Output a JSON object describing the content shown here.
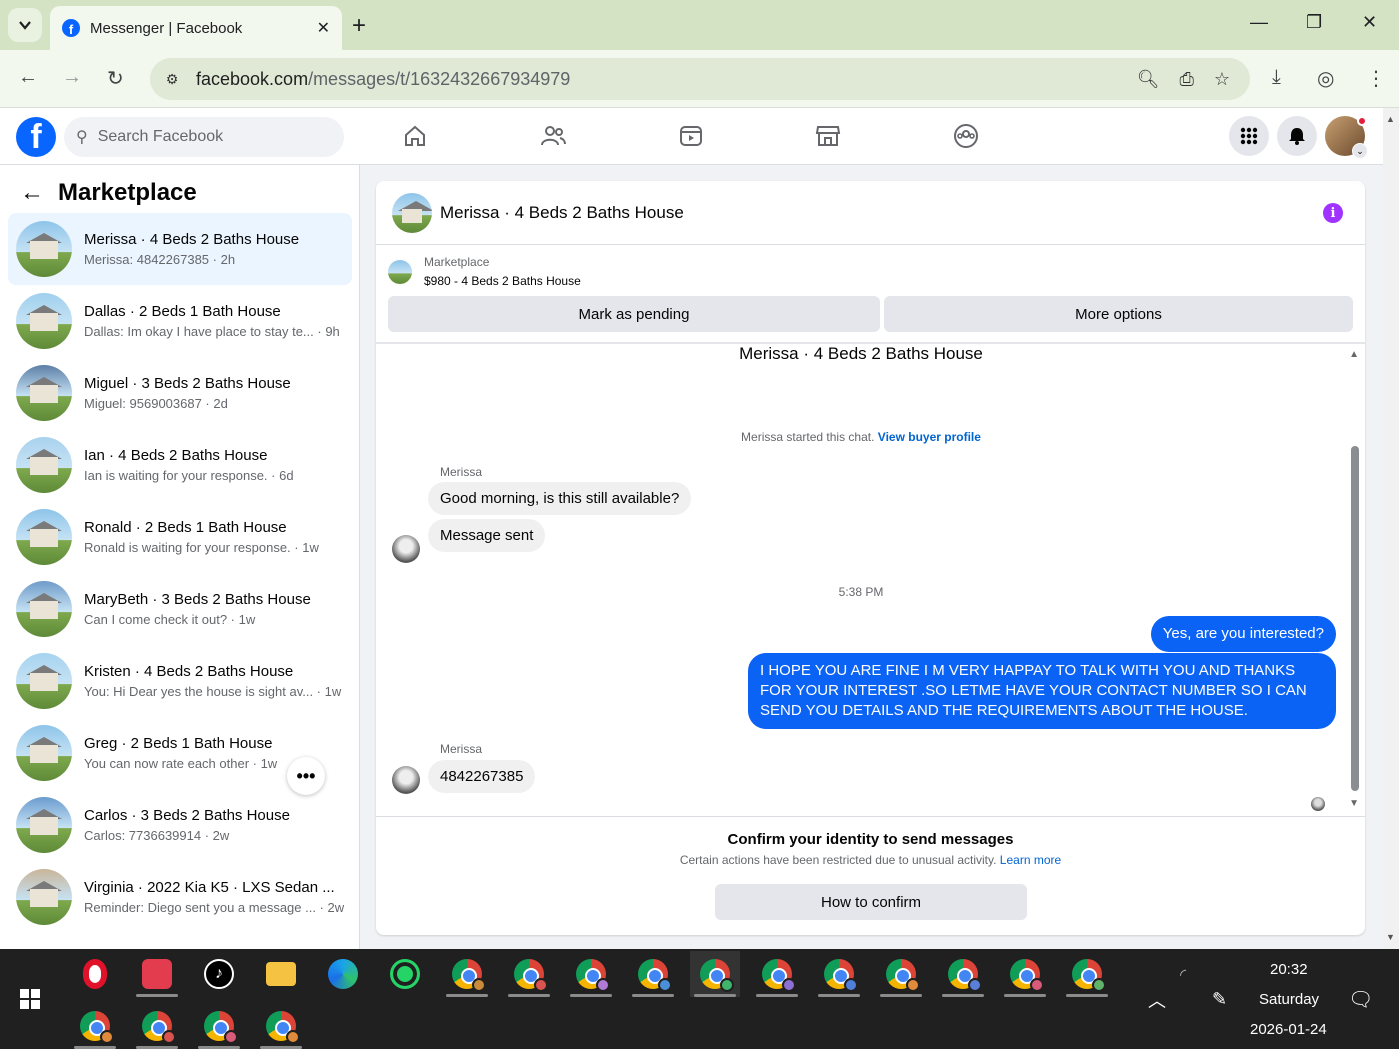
{
  "browser": {
    "tab_title": "Messenger | Facebook",
    "url_host": "facebook.com",
    "url_path": "/messages/t/1632432667934979"
  },
  "fb": {
    "search_placeholder": "Search Facebook"
  },
  "sidebar": {
    "title": "Marketplace",
    "conversations": [
      {
        "name": "Merissa · 4 Beds 2 Baths House",
        "preview": "Merissa: 4842267385 · 2h"
      },
      {
        "name": "Dallas · 2 Beds 1 Bath House",
        "preview": "Dallas: Im okay I have place to stay te... · 9h"
      },
      {
        "name": "Miguel · 3 Beds 2 Baths House",
        "preview": "Miguel: 9569003687 · 2d"
      },
      {
        "name": "Ian · 4 Beds 2 Baths House",
        "preview": "Ian is waiting for your response. · 6d"
      },
      {
        "name": "Ronald · 2 Beds 1 Bath House",
        "preview": "Ronald is waiting for your response. · 1w"
      },
      {
        "name": "MaryBeth · 3 Beds 2 Baths House",
        "preview": "Can I come check it out? · 1w"
      },
      {
        "name": "Kristen · 4 Beds 2 Baths House",
        "preview": "You: Hi Dear yes the house is sight av... · 1w"
      },
      {
        "name": "Greg · 2 Beds 1 Bath House",
        "preview": "You can now rate each other · 1w"
      },
      {
        "name": "Carlos · 3 Beds 2 Baths House",
        "preview": "Carlos: 7736639914 · 2w"
      },
      {
        "name": "Virginia · 2022 Kia K5 · LXS Sedan ...",
        "preview": "Reminder: Diego sent you a message ... · 2w"
      }
    ]
  },
  "chat": {
    "header_name": "Merissa · 4 Beds 2 Baths House",
    "marketplace_label": "Marketplace",
    "listing": "$980 - 4 Beds 2 Baths House",
    "mark_pending": "Mark as pending",
    "more_options": "More options",
    "thread_title": "Merissa · 4 Beds 2 Baths House",
    "started_text": "Merissa started this chat.",
    "view_profile": "View buyer profile",
    "sender_name": "Merissa",
    "msg1": "Good morning, is this still available?",
    "msg2": "Message sent",
    "timestamp": "5:38 PM",
    "out1": "Yes, are you interested?",
    "out2": "I HOPE YOU ARE FINE I M VERY HAPPAY TO TALK WITH YOU AND THANKS FOR YOUR INTEREST .SO LETME HAVE YOUR CONTACT NUMBER SO I CAN SEND YOU DETAILS AND THE REQUIREMENTS ABOUT THE HOUSE.",
    "msg3": "4842267385",
    "confirm_title": "Confirm your identity to send messages",
    "confirm_text": "Certain actions have been restricted due to unusual activity.",
    "learn_more": "Learn more",
    "confirm_button": "How to confirm"
  },
  "taskbar": {
    "time": "20:32",
    "day": "Saturday",
    "date": "2026-01-24"
  },
  "colors": {
    "fb_blue": "#0866ff",
    "bubble_out": "#0a63f5",
    "info_purple": "#a033ff"
  }
}
